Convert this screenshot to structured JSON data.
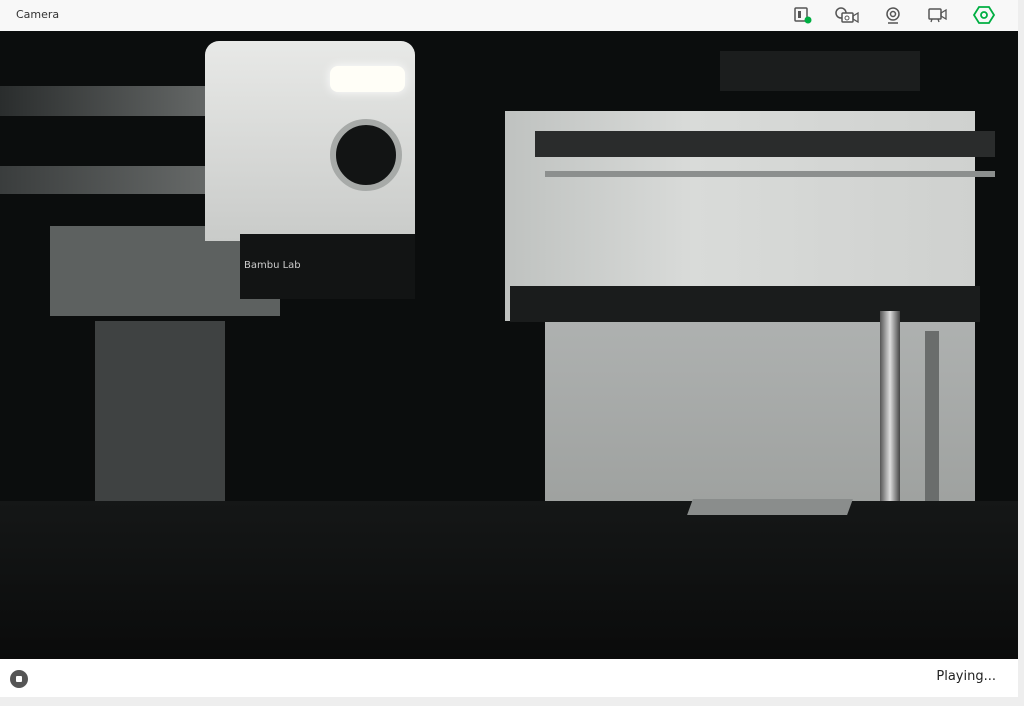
{
  "header": {
    "title": "Camera"
  },
  "toolbar": {
    "icons": [
      "sd-card-status-icon",
      "timelapse-icon",
      "webcam-icon",
      "record-video-icon",
      "settings-hex-icon"
    ],
    "accent": "#00ae42"
  },
  "video": {
    "logo_text": "Bambu Lab"
  },
  "footer": {
    "status": "Playing..."
  }
}
